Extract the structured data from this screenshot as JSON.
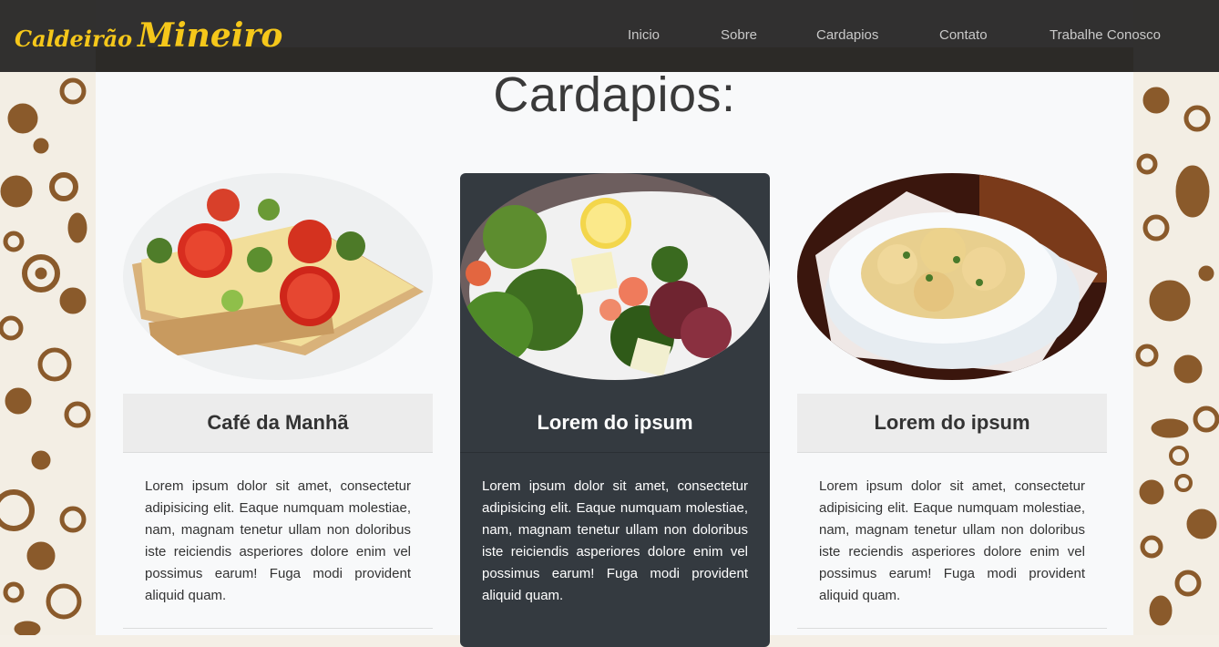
{
  "brand": {
    "part1": "Caldeirão",
    "part2": "Mineiro"
  },
  "nav": [
    {
      "label": "Inicio"
    },
    {
      "label": "Sobre"
    },
    {
      "label": "Cardapios"
    },
    {
      "label": "Contato"
    },
    {
      "label": "Trabalhe Conosco"
    }
  ],
  "page": {
    "title": "Cardapios:"
  },
  "cards": [
    {
      "title": "Café da Manhã",
      "text": "Lorem ipsum dolor sit amet, consectetur adipisicing elit. Eaque numquam molestiae, nam, magnam tenetur ullam non doloribus iste reiciendis asperiores dolore enim vel possimus earum! Fuga modi provident aliquid quam."
    },
    {
      "title": "Lorem do ipsum",
      "text": "Lorem ipsum dolor sit amet, consectetur adipisicing elit. Eaque numquam molestiae, nam, magnam tenetur ullam non doloribus iste reiciendis asperiores dolore enim vel possimus earum! Fuga modi provident aliquid quam."
    },
    {
      "title": "Lorem do ipsum",
      "text": "Lorem ipsum dolor sit amet, consectetur adipisicing elit. Eaque numquam molestiae, nam, magnam tenetur ullam non doloribus iste reciendis asperiores dolore enim vel possimus earum! Fuga modi provident aliquid quam."
    }
  ],
  "colors": {
    "brand": "#f5c71a",
    "pattern": "#8a5a2b",
    "dark_card": "#343a40"
  }
}
